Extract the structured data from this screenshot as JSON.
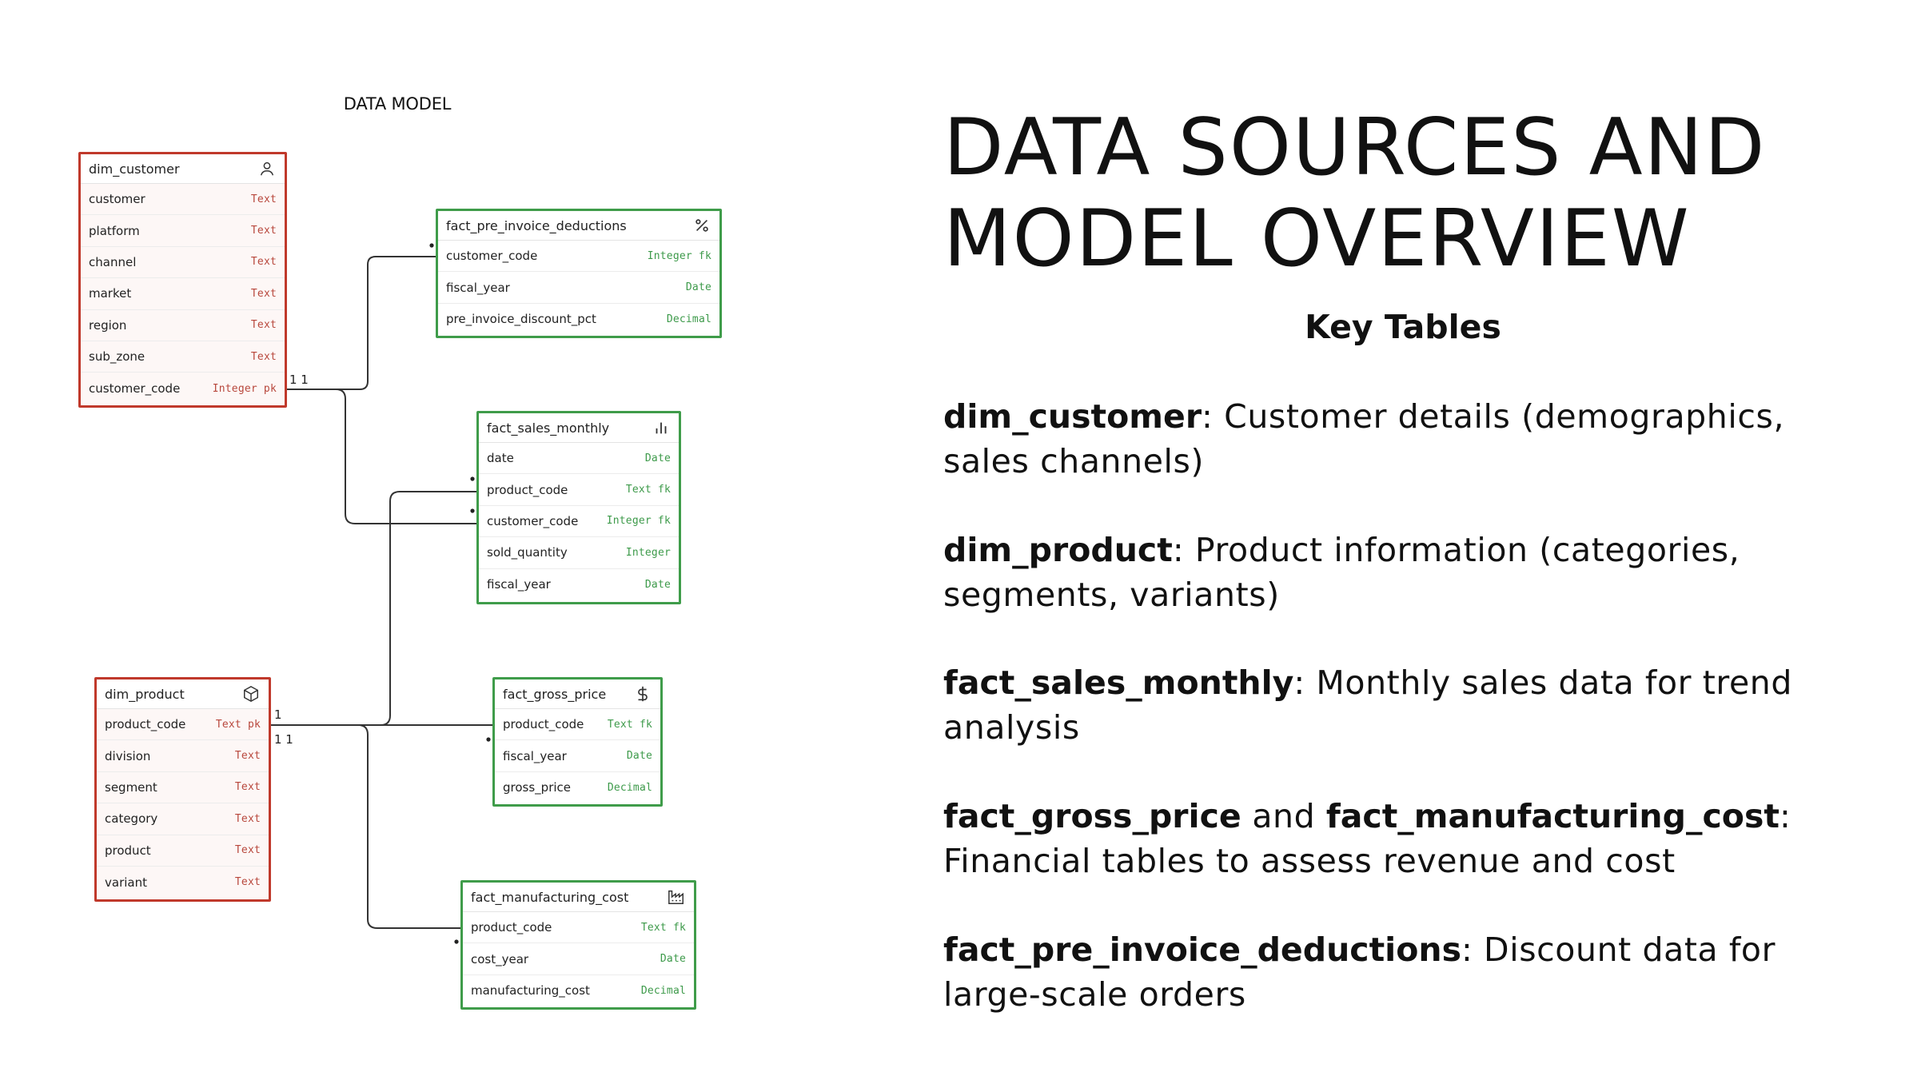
{
  "diagram": {
    "title": "DATA MODEL",
    "colors": {
      "dimension_border": "#c0392b",
      "fact_border": "#3f9c4a",
      "dimension_type": "#b8473c",
      "fact_type": "#3d9a4a",
      "connector": "#333333"
    },
    "tables": {
      "dim_customer": {
        "name": "dim_customer",
        "icon": "user-icon",
        "columns": [
          {
            "name": "customer",
            "type": "Text"
          },
          {
            "name": "platform",
            "type": "Text"
          },
          {
            "name": "channel",
            "type": "Text"
          },
          {
            "name": "market",
            "type": "Text"
          },
          {
            "name": "region",
            "type": "Text"
          },
          {
            "name": "sub_zone",
            "type": "Text"
          },
          {
            "name": "customer_code",
            "type": "Integer pk"
          }
        ]
      },
      "fact_pre_invoice_deductions": {
        "name": "fact_pre_invoice_deductions",
        "icon": "percent-icon",
        "columns": [
          {
            "name": "customer_code",
            "type": "Integer fk"
          },
          {
            "name": "fiscal_year",
            "type": "Date"
          },
          {
            "name": "pre_invoice_discount_pct",
            "type": "Decimal"
          }
        ]
      },
      "fact_sales_monthly": {
        "name": "fact_sales_monthly",
        "icon": "bar-chart-icon",
        "columns": [
          {
            "name": "date",
            "type": "Date"
          },
          {
            "name": "product_code",
            "type": "Text fk"
          },
          {
            "name": "customer_code",
            "type": "Integer fk"
          },
          {
            "name": "sold_quantity",
            "type": "Integer"
          },
          {
            "name": "fiscal_year",
            "type": "Date"
          }
        ]
      },
      "dim_product": {
        "name": "dim_product",
        "icon": "box-icon",
        "columns": [
          {
            "name": "product_code",
            "type": "Text pk"
          },
          {
            "name": "division",
            "type": "Text"
          },
          {
            "name": "segment",
            "type": "Text"
          },
          {
            "name": "category",
            "type": "Text"
          },
          {
            "name": "product",
            "type": "Text"
          },
          {
            "name": "variant",
            "type": "Text"
          }
        ]
      },
      "fact_gross_price": {
        "name": "fact_gross_price",
        "icon": "dollar-icon",
        "columns": [
          {
            "name": "product_code",
            "type": "Text fk"
          },
          {
            "name": "fiscal_year",
            "type": "Date"
          },
          {
            "name": "gross_price",
            "type": "Decimal"
          }
        ]
      },
      "fact_manufacturing_cost": {
        "name": "fact_manufacturing_cost",
        "icon": "factory-icon",
        "columns": [
          {
            "name": "product_code",
            "type": "Text fk"
          },
          {
            "name": "cost_year",
            "type": "Date"
          },
          {
            "name": "manufacturing_cost",
            "type": "Decimal"
          }
        ]
      }
    },
    "cardinality_labels": {
      "customer_one_one": "1 1",
      "product_one": "1",
      "product_one_one": "1 1"
    }
  },
  "slide": {
    "heading_line1": "DATA SOURCES AND",
    "heading_line2": "MODEL OVERVIEW",
    "subheading": "Key Tables",
    "items": [
      {
        "term": "dim_customer",
        "text": ": Customer details (demographics, sales channels)"
      },
      {
        "term": "dim_product",
        "text": ": Product information (categories, segments, variants)"
      },
      {
        "term": "fact_sales_monthly",
        "text": ": Monthly sales data for trend analysis"
      },
      {
        "term": "fact_gross_price",
        "connector": " and ",
        "term2": "fact_manufacturing_cost",
        "text": ": Financial tables to assess revenue and cost"
      },
      {
        "term": "fact_pre_invoice_deductions",
        "text": ": Discount data for large-scale orders"
      }
    ]
  }
}
